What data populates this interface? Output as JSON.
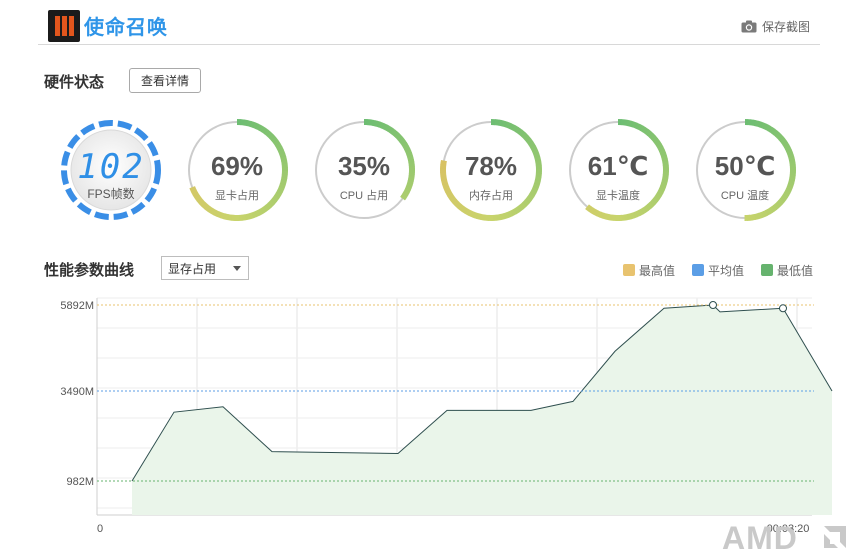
{
  "header": {
    "app_title": "使命召唤",
    "logo_icon": "black-ops-3-logo",
    "screenshot_label": "保存截图",
    "screenshot_icon": "camera-icon"
  },
  "hardware": {
    "title": "硬件状态",
    "details_button": "查看详情",
    "fps": {
      "value": "102",
      "label": "FPS帧数"
    },
    "gauges": [
      {
        "id": "gpu-usage",
        "value": "69%",
        "label": "显卡占用",
        "level": 0.69
      },
      {
        "id": "cpu-usage",
        "value": "35%",
        "label": "CPU 占用",
        "level": 0.35
      },
      {
        "id": "memory-usage",
        "value": "78%",
        "label": "内存占用",
        "level": 0.78
      },
      {
        "id": "gpu-temp",
        "value": "61℃",
        "label": "显卡温度",
        "level": 0.61
      },
      {
        "id": "cpu-temp",
        "value": "50℃",
        "label": "CPU 温度",
        "level": 0.5
      }
    ],
    "colors": {
      "fps_ring": "#3a8ee6",
      "arc_start": "#6cbd72",
      "arc_mid": "#c8d46c",
      "arc_end": "#e5b35d",
      "track": "#cccccc"
    }
  },
  "curve": {
    "title": "性能参数曲线",
    "metric_selected": "显存占用",
    "legend": [
      {
        "label": "最高值",
        "color": "#e8c36f"
      },
      {
        "label": "平均值",
        "color": "#5b9ee6"
      },
      {
        "label": "最低值",
        "color": "#66b36e"
      }
    ]
  },
  "chart_data": {
    "type": "area",
    "ytick_labels": [
      "5892M",
      "3490M",
      "982M"
    ],
    "yticks": [
      5892,
      3490,
      982
    ],
    "xtick_labels": [
      "0",
      "00:03:20"
    ],
    "x": [
      0.05,
      0.11,
      0.18,
      0.25,
      0.4,
      0.5,
      0.62,
      0.7,
      0.75,
      0.82,
      0.88,
      0.95,
      0.99
    ],
    "values": [
      982,
      2900,
      3050,
      1800,
      1750,
      2950,
      2950,
      3200,
      4600,
      5800,
      5892,
      5700,
      5800,
      3490
    ],
    "points": [
      [
        0.05,
        982
      ],
      [
        0.11,
        2900
      ],
      [
        0.18,
        3050
      ],
      [
        0.25,
        1800
      ],
      [
        0.43,
        1750
      ],
      [
        0.5,
        2950
      ],
      [
        0.62,
        2950
      ],
      [
        0.68,
        3200
      ],
      [
        0.74,
        4600
      ],
      [
        0.81,
        5800
      ],
      [
        0.88,
        5892
      ],
      [
        0.89,
        5700
      ],
      [
        0.98,
        5800
      ],
      [
        1.05,
        3490
      ]
    ],
    "max": 5892,
    "avg": 3490,
    "min": 982,
    "ylim": [
      0,
      6500
    ],
    "grid": true,
    "line_color": "#2f4f4f",
    "fill_color": "#eaf5ea"
  },
  "watermark": "AMD"
}
